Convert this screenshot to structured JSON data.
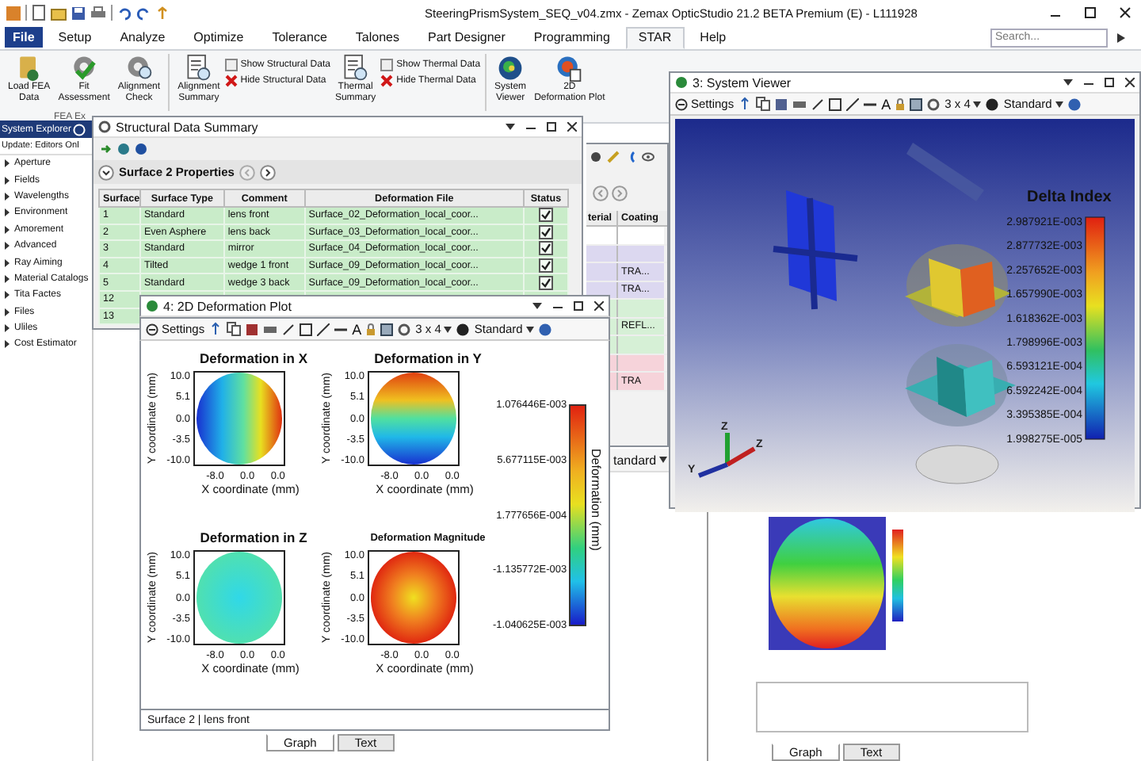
{
  "title_bar": {
    "title": "SteeringPrismSystem_SEQ_v04.zmx - Zemax OpticStudio 21.2  BETA  Premium (E) - L111928"
  },
  "ribbon_tabs": [
    {
      "label": "File",
      "kind": "file",
      "selected": false
    },
    {
      "label": "Setup",
      "kind": "tab",
      "selected": false
    },
    {
      "label": "Analyze",
      "kind": "tab",
      "selected": false
    },
    {
      "label": "Optimize",
      "kind": "tab",
      "selected": false
    },
    {
      "label": "Tolerance",
      "kind": "tab",
      "selected": false
    },
    {
      "label": "Talones",
      "kind": "tab",
      "selected": false
    },
    {
      "label": "Part Designer",
      "kind": "tab",
      "selected": false
    },
    {
      "label": "Programming",
      "kind": "tab",
      "selected": false
    },
    {
      "label": "STAR",
      "kind": "tab",
      "selected": true
    },
    {
      "label": "Help",
      "kind": "tab",
      "selected": false
    }
  ],
  "search": {
    "placeholder": "Search..."
  },
  "ribbon": {
    "group_label": "FEA Ex",
    "items": [
      {
        "kind": "large",
        "lines": [
          "Load FEA",
          "Data"
        ]
      },
      {
        "kind": "large",
        "lines": [
          "Fit",
          "Assessment"
        ]
      },
      {
        "kind": "large",
        "lines": [
          "Alignment",
          "Check"
        ]
      },
      {
        "kind": "large",
        "lines": [
          "Alignment",
          "Summary"
        ]
      },
      {
        "kind": "stack",
        "show": "Show Structural Data",
        "hide": "Hide Structural Data"
      },
      {
        "kind": "large",
        "lines": [
          "Thermal",
          "Summary"
        ]
      },
      {
        "kind": "stack",
        "show": "Show Thermal Data",
        "hide": "Hide Thermal Data"
      },
      {
        "kind": "large",
        "lines": [
          "System",
          "Viewer"
        ]
      },
      {
        "kind": "large",
        "lines": [
          "2D",
          "Deformation Plot"
        ]
      }
    ]
  },
  "explorer": {
    "title": "System Explorer",
    "update": "Update: Editors Onl",
    "items": [
      "Aperture",
      "Fields",
      "Wavelengths",
      "Environment",
      "Amorement",
      "Advanced",
      "Ray Aiming",
      "Material Catalogs",
      "Tita Factes",
      "Files",
      "Uliles",
      "Cost Estimator"
    ]
  },
  "structural": {
    "title": "Structural Data Summary",
    "nav": "Surface  2 Properties",
    "columns": [
      "Surface",
      "Surface Type",
      "Comment",
      "Deformation File",
      "Status"
    ],
    "rows": [
      {
        "cells": [
          "1",
          "Standard",
          "lens front",
          "Surface_02_Deformation_local_coor..."
        ],
        "checked": true
      },
      {
        "cells": [
          "2",
          "Even Asphere",
          "lens back",
          "Surface_03_Deformation_local_coor..."
        ],
        "checked": true
      },
      {
        "cells": [
          "3",
          "Standard",
          "mirror",
          "Surface_04_Deformation_local_coor..."
        ],
        "checked": true
      },
      {
        "cells": [
          "4",
          "Tilted",
          "wedge 1 front",
          "Surface_09_Deformation_local_coor..."
        ],
        "checked": true
      },
      {
        "cells": [
          "5",
          "Standard",
          "wedge 3 back",
          "Surface_09_Deformation_local_coor..."
        ],
        "checked": true
      },
      {
        "cells": [
          "12"
        ]
      },
      {
        "cells": [
          "13"
        ]
      }
    ]
  },
  "lens_editor": {
    "columns": [
      "terial",
      "Coating"
    ],
    "rows": [
      {
        "color": "#ffffff"
      },
      {
        "color": "#dcd8f0"
      },
      {
        "color": "#dcd8f0",
        "coating": "TRA..."
      },
      {
        "color": "#dcd8f0",
        "coating": "TRA..."
      },
      {
        "color": "#d6f0d6"
      },
      {
        "color": "#d6f0d6",
        "coating": "REFL..."
      },
      {
        "color": "#d6f0d6"
      },
      {
        "color": "#f6d3da"
      },
      {
        "color": "#f6d3da",
        "coating": "TRA"
      }
    ]
  },
  "deformation_window": {
    "title": "4: 2D Deformation Plot",
    "toolbar": {
      "settings": "Settings",
      "text_tool": "A",
      "layout": "3 x 4",
      "mode": "Standard"
    },
    "plots": [
      {
        "title": "Deformation in X",
        "kind": "horizontal",
        "small_title": false,
        "ylabel": "Y coordinate (mm)",
        "xlabel": "X coordinate (mm)",
        "yticks": [
          "10.0",
          "5.1",
          "0.0",
          "-3.5",
          "-10.0"
        ],
        "xticks": [
          "-8.0",
          "0.0",
          "0.0"
        ]
      },
      {
        "title": "Deformation in Y",
        "kind": "vertical",
        "small_title": false,
        "ylabel": "Y coordinate (mm)",
        "xlabel": "X coordinate (mm)",
        "yticks": [
          "10.0",
          "5.1",
          "0.0",
          "-3.5",
          "-10.0"
        ],
        "xticks": [
          "-8.0",
          "0.0",
          "0.0"
        ]
      },
      {
        "title": "Deformation in Z",
        "kind": "flat",
        "small_title": false,
        "ylabel": "Y coordinate (mm)",
        "xlabel": "X coordinate (mm)",
        "yticks": [
          "10.0",
          "5.1",
          "0.0",
          "-3.5",
          "-10.0"
        ],
        "xticks": [
          "-8.0",
          "0.0",
          "0.0"
        ]
      },
      {
        "title": "Deformation Magnitude",
        "kind": "radial",
        "small_title": true,
        "ylabel": "Y coordinate (mm)",
        "xlabel": "X coordinate (mm)",
        "yticks": [
          "10.0",
          "5.1",
          "0.0",
          "-3.5",
          "-10.0"
        ],
        "xticks": [
          "-8.0",
          "0.0",
          "0.0"
        ]
      }
    ],
    "scale_labels": [
      "1.076446E-003",
      "5.677115E-003",
      "1.777656E-004",
      "-1.135772E-003",
      "-1.040625E-003"
    ],
    "scale_title": "Deformation (mm)",
    "status": "Surface 2 | lens front",
    "tabs": [
      {
        "label": "Graph",
        "selected": true
      },
      {
        "label": "Text",
        "selected": false
      }
    ]
  },
  "viewer_window": {
    "title": "3: System Viewer",
    "toolbar": {
      "settings": "Settings",
      "text_tool": "A",
      "layout": "3 x 4",
      "mode": "Standard"
    },
    "legend_title": "Delta Index",
    "legend_labels": [
      "2.987921E-003",
      "2.877732E-003",
      "2.257652E-003",
      "1.657990E-003",
      "1.618362E-003",
      "1.798996E-003",
      "6.593121E-004",
      "6.592242E-004",
      "3.395385E-004",
      "1.998275E-005"
    ],
    "axes": [
      "Y",
      "Z",
      "Z"
    ]
  },
  "surface_window": {
    "mode": "tandard",
    "tabs": [
      {
        "label": "Graph",
        "selected": true
      },
      {
        "label": "Text",
        "selected": false
      }
    ]
  }
}
